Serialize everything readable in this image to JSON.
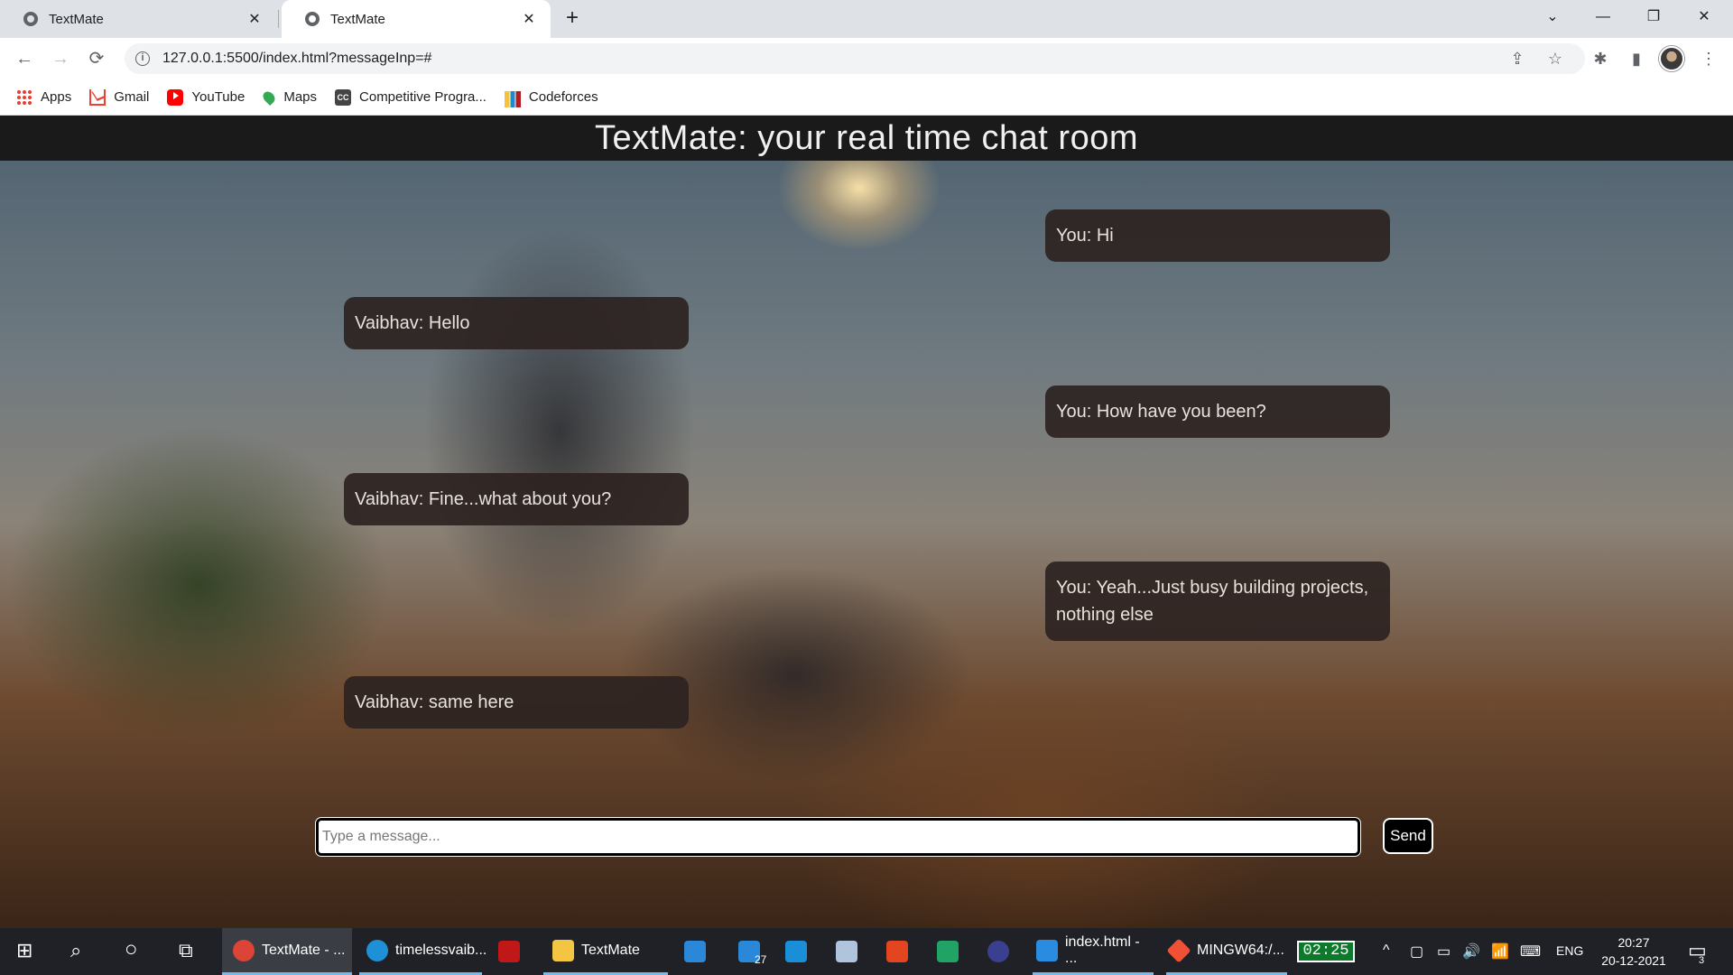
{
  "browser": {
    "tabs": [
      {
        "title": "TextMate",
        "active": false
      },
      {
        "title": "TextMate",
        "active": true
      }
    ],
    "new_tab": "+",
    "window_controls": {
      "tab_search": "⌄",
      "minimize": "—",
      "restore": "❐",
      "close": "✕"
    },
    "nav": {
      "back": "←",
      "forward": "→",
      "reload": "⟳"
    },
    "url": "127.0.0.1:5500/index.html?messageInp=#",
    "info_glyph": "i",
    "omnibox_actions": {
      "share": "⇪",
      "bookmark": "☆"
    },
    "toolbar_actions": {
      "extensions": "✱",
      "side_panel": "▮",
      "menu": "⋮"
    },
    "bookmarks": [
      {
        "label": "Apps",
        "icon": "apps-icon"
      },
      {
        "label": "Gmail",
        "icon": "gmail-icon"
      },
      {
        "label": "YouTube",
        "icon": "youtube-icon"
      },
      {
        "label": "Maps",
        "icon": "maps-icon"
      },
      {
        "label": "Competitive Progra...",
        "icon": "cc-icon"
      },
      {
        "label": "Codeforces",
        "icon": "codeforces-icon"
      }
    ]
  },
  "page": {
    "title": "TextMate: your real time chat room",
    "messages": [
      {
        "text": "You: Hi",
        "side": "right"
      },
      {
        "text": "Vaibhav: Hello",
        "side": "left"
      },
      {
        "text": "You: How have you been?",
        "side": "right"
      },
      {
        "text": "Vaibhav: Fine...what about you?",
        "side": "left"
      },
      {
        "text": "You: Yeah...Just busy building projects, nothing else",
        "side": "right"
      },
      {
        "text": "Vaibhav: same here",
        "side": "left"
      }
    ],
    "composer": {
      "placeholder": "Type a message...",
      "value": "",
      "send_label": "Send"
    }
  },
  "taskbar": {
    "start_glyph": "⊞",
    "search_glyph": "⌕",
    "cortana_glyph": "○",
    "task_view_glyph": "⧉",
    "apps": [
      {
        "label": "TextMate - ...",
        "icon": "chrome-icon",
        "color": "#db4437"
      },
      {
        "label": "timelessvaib...",
        "icon": "edge-icon",
        "color": "#1e90d6"
      },
      {
        "label": "",
        "icon": "mcafee-icon",
        "color": "#c01818"
      },
      {
        "label": "TextMate",
        "icon": "folder-icon",
        "color": "#f4c542"
      },
      {
        "label": "",
        "icon": "mail-icon",
        "color": "#2b88d8"
      },
      {
        "label": "27",
        "icon": "calendar-icon",
        "color": "#2b88d8"
      },
      {
        "label": "",
        "icon": "l-app-icon",
        "color": "#1a8fd8"
      },
      {
        "label": "",
        "icon": "3d-box-icon",
        "color": "#b0c4de"
      },
      {
        "label": "",
        "icon": "office-icon",
        "color": "#e2451f"
      },
      {
        "label": "",
        "icon": "arrow-app-icon",
        "color": "#21a366"
      },
      {
        "label": "",
        "icon": "eclipse-icon",
        "color": "#3b3f8f"
      },
      {
        "label": "index.html - ...",
        "icon": "vscode-icon",
        "color": "#2a8ce0"
      },
      {
        "label": "MINGW64:/...",
        "icon": "git-bash-icon",
        "color": "#f05033"
      }
    ],
    "battery_timer": "02:25",
    "tray": {
      "chevron": "^",
      "glyphs": [
        "▢",
        "▭",
        "🔊",
        "📶",
        "⌨"
      ],
      "lang": "ENG",
      "time": "20:27",
      "date": "20-12-2021",
      "notifications": "3"
    }
  }
}
